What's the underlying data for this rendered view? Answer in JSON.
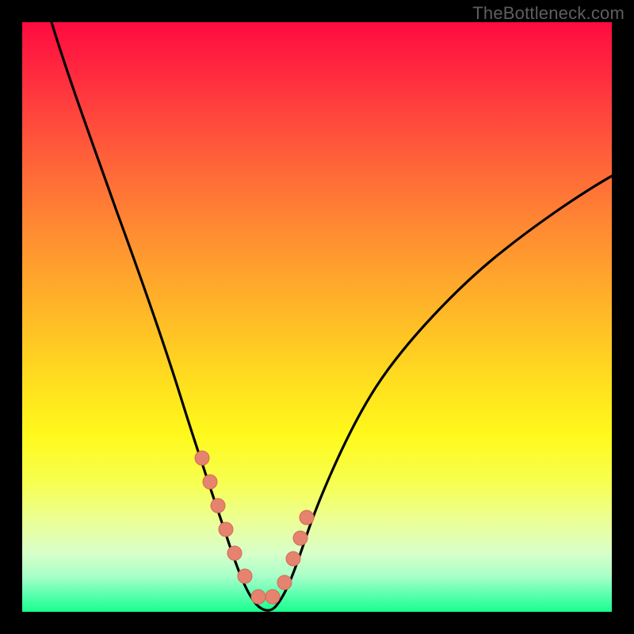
{
  "watermark": "TheBottleneck.com",
  "colors": {
    "frame_bg": "#000000",
    "curve": "#000000",
    "marker_fill": "#e5836f",
    "marker_stroke": "#d46a57",
    "gradient_stops": [
      "#ff0b3f",
      "#ff2f3f",
      "#ff5d3a",
      "#ff8a32",
      "#ffb428",
      "#ffdb1f",
      "#fff91c",
      "#f7ff4f",
      "#eaff9a",
      "#d9ffc9",
      "#a8ffc8",
      "#5dffb0",
      "#18ff8e"
    ]
  },
  "chart_data": {
    "type": "line",
    "title": "",
    "xlabel": "",
    "ylabel": "",
    "xlim": [
      0,
      100
    ],
    "ylim": [
      0,
      100
    ],
    "grid": false,
    "legend": null,
    "note": "Values are read in screen-percent coordinates; y is the visual height from bottom (0) to top (100). Axes are unlabeled in the source image.",
    "series": [
      {
        "name": "bottleneck-curve",
        "x": [
          5,
          8,
          12,
          16,
          20,
          24,
          27,
          30,
          33,
          35,
          37,
          39,
          41,
          43,
          46,
          48,
          50,
          55,
          60,
          65,
          70,
          75,
          80,
          85,
          90,
          95,
          100
        ],
        "y": [
          100,
          90,
          79,
          68,
          57,
          46,
          37,
          28,
          19,
          12,
          7,
          3,
          1,
          1,
          3,
          8,
          14,
          27,
          38,
          47,
          54,
          60,
          65,
          69,
          72,
          75,
          77
        ]
      }
    ],
    "markers": {
      "name": "highlight-dots",
      "x": [
        30.5,
        31.8,
        33.2,
        34.5,
        36.0,
        37.8,
        40.0,
        42.5,
        44.5,
        46.0,
        47.2,
        48.3
      ],
      "y": [
        26,
        22,
        18,
        14,
        10,
        6,
        2.5,
        2.5,
        5,
        9,
        12.5,
        16
      ]
    }
  }
}
